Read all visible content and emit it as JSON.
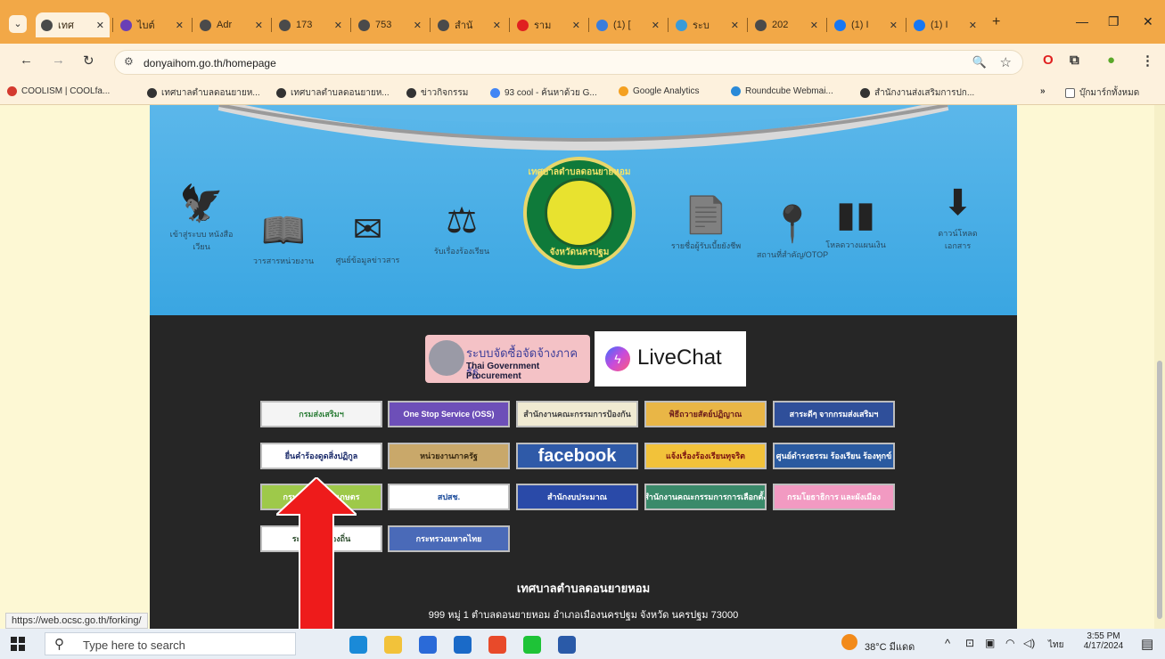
{
  "browser": {
    "tabs": [
      {
        "label": "เทศ",
        "icon": "globe-icon",
        "color": "#4a4a4a",
        "active": true
      },
      {
        "label": "ไบต์",
        "icon": "sheets-icon",
        "color": "#6a3fb5"
      },
      {
        "label": "Adr",
        "icon": "globe-icon",
        "color": "#4a4a4a"
      },
      {
        "label": "173",
        "icon": "globe-icon",
        "color": "#4a4a4a"
      },
      {
        "label": "753",
        "icon": "globe-icon",
        "color": "#4a4a4a"
      },
      {
        "label": "สำนั",
        "icon": "globe-icon",
        "color": "#4a4a4a"
      },
      {
        "label": "ราม",
        "icon": "youtube-icon",
        "color": "#e02020"
      },
      {
        "label": "(1) [",
        "icon": "mail-icon",
        "color": "#3a7ddb"
      },
      {
        "label": "ระบ",
        "icon": "globe-icon",
        "color": "#3a9bd8"
      },
      {
        "label": "202",
        "icon": "globe-icon",
        "color": "#4a4a4a"
      },
      {
        "label": "(1) I",
        "icon": "facebook-icon",
        "color": "#1877f2"
      },
      {
        "label": "(1) I",
        "icon": "facebook-icon",
        "color": "#1877f2"
      }
    ],
    "url": "donyaihom.go.th/homepage",
    "bookmarks": [
      {
        "label": "COOLISM | COOLfa...",
        "color": "#d43a2f"
      },
      {
        "label": "เทศบาลตำบลดอนยายห...",
        "color": "#333333"
      },
      {
        "label": "เทศบาลตำบลดอนยายห...",
        "color": "#333333"
      },
      {
        "label": "ข่าวกิจกรรม",
        "color": "#333333"
      },
      {
        "label": "93 cool - ค้นหาด้วย G...",
        "color": "#4285f4"
      },
      {
        "label": "Google Analytics",
        "color": "#f4a020"
      },
      {
        "label": "Roundcube Webmai...",
        "color": "#2a8ad8"
      },
      {
        "label": "สำนักงานส่งเสริมการปก...",
        "color": "#333333"
      }
    ],
    "bookmarks_more": "»",
    "bookmarks_folder": "บุ๊กมาร์กทั้งหมด",
    "status_url": "https://web.ocsc.go.th/forking/"
  },
  "site": {
    "header_icons": [
      {
        "name": "garuda-icon",
        "label": "เข้าสู่ระบบ หนังสือเวียน"
      },
      {
        "name": "book-icon",
        "label": "วารสารหน่วยงาน"
      },
      {
        "name": "mail-icon",
        "label": "ศูนย์ข้อมูลข่าวสาร"
      },
      {
        "name": "scales-icon",
        "label": "รับเรื่องร้องเรียน"
      },
      {
        "name": "document-icon",
        "label": "รายชื่อผู้รับเบี้ยยังชีพ"
      },
      {
        "name": "location-pin-icon",
        "label": "สถานที่สำคัญ/OTOP"
      },
      {
        "name": "bar-chart-icon",
        "label": "โหลดวางแผนเงิน"
      },
      {
        "name": "download-icon",
        "label": "ดาวน์โหลด เอกสาร"
      }
    ],
    "seal": {
      "top": "เทศบาลตำบลดอนยายหอม",
      "bottom": "จังหวัดนครปฐม"
    },
    "procurement": {
      "line1": "ระบบจัดซื้อจัดจ้างภาครัฐ",
      "line2": "Thai Government Procurement"
    },
    "livechat": "LiveChat",
    "banners": [
      {
        "text": "กรมส่งเสริมฯ",
        "bg": "#f4f4f4",
        "fg": "#2f7f3a"
      },
      {
        "text": "One Stop Service (OSS)",
        "bg": "#6d4fb8",
        "fg": "#ffffff"
      },
      {
        "text": "สำนักงานคณะกรรมการป้องกัน",
        "bg": "#f0ead2",
        "fg": "#444444"
      },
      {
        "text": "พิธีถวายสัตย์ปฏิญาณ",
        "bg": "#e9b646",
        "fg": "#6b1b1b"
      },
      {
        "text": "สาระดีๆ จากกรมส่งเสริมฯ",
        "bg": "#2f4f9a",
        "fg": "#ffffff"
      },
      {
        "text": "ยื่นคำร้องดูดสิ่งปฏิกูล",
        "bg": "#ffffff",
        "fg": "#1a2a6a"
      },
      {
        "text": "หน่วยงานภาครัฐ",
        "bg": "#c9a86a",
        "fg": "#3a2a10"
      },
      {
        "text": "facebook",
        "bg": "#2f5aa8",
        "fg": "#ffffff"
      },
      {
        "text": "แจ้งเรื่องร้องเรียนทุจริต",
        "bg": "#f2c23a",
        "fg": "#7a1010"
      },
      {
        "text": "ศูนย์ดำรงธรรม ร้องเรียน ร้องทุกข์",
        "bg": "#2a5aa0",
        "fg": "#ffffff"
      },
      {
        "text": "กรมส่งเสริมการเกษตร",
        "bg": "#9ec94a",
        "fg": "#ffffff"
      },
      {
        "text": "สปสช.",
        "bg": "#ffffff",
        "fg": "#1a4a9a"
      },
      {
        "text": "สำนักงบประมาณ",
        "bg": "#2a4aa8",
        "fg": "#ffffff"
      },
      {
        "text": "สำนักงานคณะกรรมการการเลือกตั้ง",
        "bg": "#3a8a6a",
        "fg": "#ffffff"
      },
      {
        "text": "กรมโยธาธิการ และผังเมือง",
        "bg": "#f29ac2",
        "fg": "#ffffff"
      },
      {
        "text": "ระบบ ร้องท้องถิ่น",
        "bg": "#ffffff",
        "fg": "#2a4a2a"
      },
      {
        "text": "กระทรวงมหาดไทย",
        "bg": "#4a6ab8",
        "fg": "#ffffff"
      }
    ],
    "footer_name": "เทศบาลตำบลดอนยายหอม",
    "footer_address": "999 หมู่ 1 ตำบลดอนยายหอม อำเภอเมืองนครปฐม จังหวัด นครปฐม 73000"
  },
  "taskbar": {
    "search_placeholder": "Type here to search",
    "apps": [
      {
        "name": "edge-icon",
        "color": "#1a8ad8"
      },
      {
        "name": "file-explorer-icon",
        "color": "#f2c23a"
      },
      {
        "name": "store-icon",
        "color": "#2a6ad8"
      },
      {
        "name": "mail-app-icon",
        "color": "#1a6ac8"
      },
      {
        "name": "chrome-icon",
        "color": "#e84a2a"
      },
      {
        "name": "line-icon",
        "color": "#1ec337"
      },
      {
        "name": "word-icon",
        "color": "#2a5aa8"
      }
    ],
    "weather": "38°C มีแดด",
    "lang": "ไทย",
    "time": "3:55 PM",
    "date": "4/17/2024"
  }
}
